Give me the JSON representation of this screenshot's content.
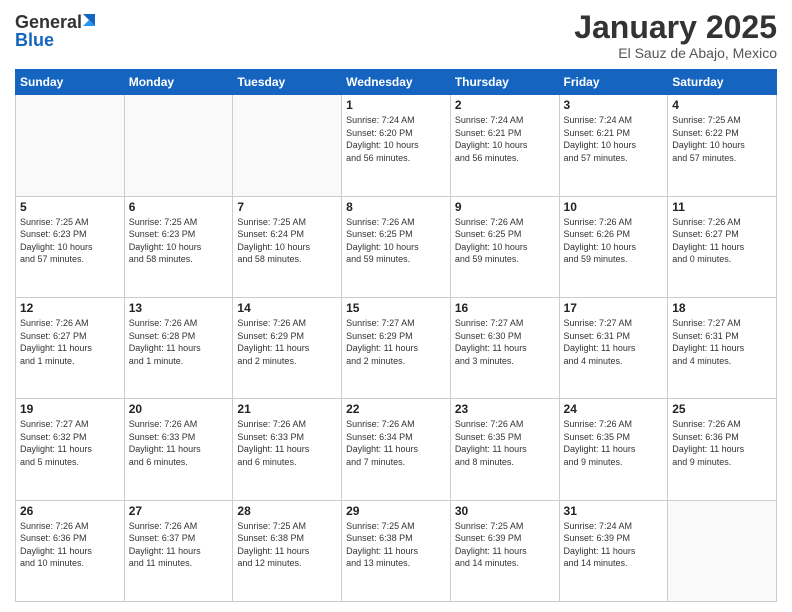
{
  "header": {
    "logo_general": "General",
    "logo_blue": "Blue",
    "title": "January 2025",
    "subtitle": "El Sauz de Abajo, Mexico"
  },
  "weekdays": [
    "Sunday",
    "Monday",
    "Tuesday",
    "Wednesday",
    "Thursday",
    "Friday",
    "Saturday"
  ],
  "weeks": [
    [
      {
        "day": "",
        "info": ""
      },
      {
        "day": "",
        "info": ""
      },
      {
        "day": "",
        "info": ""
      },
      {
        "day": "1",
        "info": "Sunrise: 7:24 AM\nSunset: 6:20 PM\nDaylight: 10 hours\nand 56 minutes."
      },
      {
        "day": "2",
        "info": "Sunrise: 7:24 AM\nSunset: 6:21 PM\nDaylight: 10 hours\nand 56 minutes."
      },
      {
        "day": "3",
        "info": "Sunrise: 7:24 AM\nSunset: 6:21 PM\nDaylight: 10 hours\nand 57 minutes."
      },
      {
        "day": "4",
        "info": "Sunrise: 7:25 AM\nSunset: 6:22 PM\nDaylight: 10 hours\nand 57 minutes."
      }
    ],
    [
      {
        "day": "5",
        "info": "Sunrise: 7:25 AM\nSunset: 6:23 PM\nDaylight: 10 hours\nand 57 minutes."
      },
      {
        "day": "6",
        "info": "Sunrise: 7:25 AM\nSunset: 6:23 PM\nDaylight: 10 hours\nand 58 minutes."
      },
      {
        "day": "7",
        "info": "Sunrise: 7:25 AM\nSunset: 6:24 PM\nDaylight: 10 hours\nand 58 minutes."
      },
      {
        "day": "8",
        "info": "Sunrise: 7:26 AM\nSunset: 6:25 PM\nDaylight: 10 hours\nand 59 minutes."
      },
      {
        "day": "9",
        "info": "Sunrise: 7:26 AM\nSunset: 6:25 PM\nDaylight: 10 hours\nand 59 minutes."
      },
      {
        "day": "10",
        "info": "Sunrise: 7:26 AM\nSunset: 6:26 PM\nDaylight: 10 hours\nand 59 minutes."
      },
      {
        "day": "11",
        "info": "Sunrise: 7:26 AM\nSunset: 6:27 PM\nDaylight: 11 hours\nand 0 minutes."
      }
    ],
    [
      {
        "day": "12",
        "info": "Sunrise: 7:26 AM\nSunset: 6:27 PM\nDaylight: 11 hours\nand 1 minute."
      },
      {
        "day": "13",
        "info": "Sunrise: 7:26 AM\nSunset: 6:28 PM\nDaylight: 11 hours\nand 1 minute."
      },
      {
        "day": "14",
        "info": "Sunrise: 7:26 AM\nSunset: 6:29 PM\nDaylight: 11 hours\nand 2 minutes."
      },
      {
        "day": "15",
        "info": "Sunrise: 7:27 AM\nSunset: 6:29 PM\nDaylight: 11 hours\nand 2 minutes."
      },
      {
        "day": "16",
        "info": "Sunrise: 7:27 AM\nSunset: 6:30 PM\nDaylight: 11 hours\nand 3 minutes."
      },
      {
        "day": "17",
        "info": "Sunrise: 7:27 AM\nSunset: 6:31 PM\nDaylight: 11 hours\nand 4 minutes."
      },
      {
        "day": "18",
        "info": "Sunrise: 7:27 AM\nSunset: 6:31 PM\nDaylight: 11 hours\nand 4 minutes."
      }
    ],
    [
      {
        "day": "19",
        "info": "Sunrise: 7:27 AM\nSunset: 6:32 PM\nDaylight: 11 hours\nand 5 minutes."
      },
      {
        "day": "20",
        "info": "Sunrise: 7:26 AM\nSunset: 6:33 PM\nDaylight: 11 hours\nand 6 minutes."
      },
      {
        "day": "21",
        "info": "Sunrise: 7:26 AM\nSunset: 6:33 PM\nDaylight: 11 hours\nand 6 minutes."
      },
      {
        "day": "22",
        "info": "Sunrise: 7:26 AM\nSunset: 6:34 PM\nDaylight: 11 hours\nand 7 minutes."
      },
      {
        "day": "23",
        "info": "Sunrise: 7:26 AM\nSunset: 6:35 PM\nDaylight: 11 hours\nand 8 minutes."
      },
      {
        "day": "24",
        "info": "Sunrise: 7:26 AM\nSunset: 6:35 PM\nDaylight: 11 hours\nand 9 minutes."
      },
      {
        "day": "25",
        "info": "Sunrise: 7:26 AM\nSunset: 6:36 PM\nDaylight: 11 hours\nand 9 minutes."
      }
    ],
    [
      {
        "day": "26",
        "info": "Sunrise: 7:26 AM\nSunset: 6:36 PM\nDaylight: 11 hours\nand 10 minutes."
      },
      {
        "day": "27",
        "info": "Sunrise: 7:26 AM\nSunset: 6:37 PM\nDaylight: 11 hours\nand 11 minutes."
      },
      {
        "day": "28",
        "info": "Sunrise: 7:25 AM\nSunset: 6:38 PM\nDaylight: 11 hours\nand 12 minutes."
      },
      {
        "day": "29",
        "info": "Sunrise: 7:25 AM\nSunset: 6:38 PM\nDaylight: 11 hours\nand 13 minutes."
      },
      {
        "day": "30",
        "info": "Sunrise: 7:25 AM\nSunset: 6:39 PM\nDaylight: 11 hours\nand 14 minutes."
      },
      {
        "day": "31",
        "info": "Sunrise: 7:24 AM\nSunset: 6:39 PM\nDaylight: 11 hours\nand 14 minutes."
      },
      {
        "day": "",
        "info": ""
      }
    ]
  ]
}
